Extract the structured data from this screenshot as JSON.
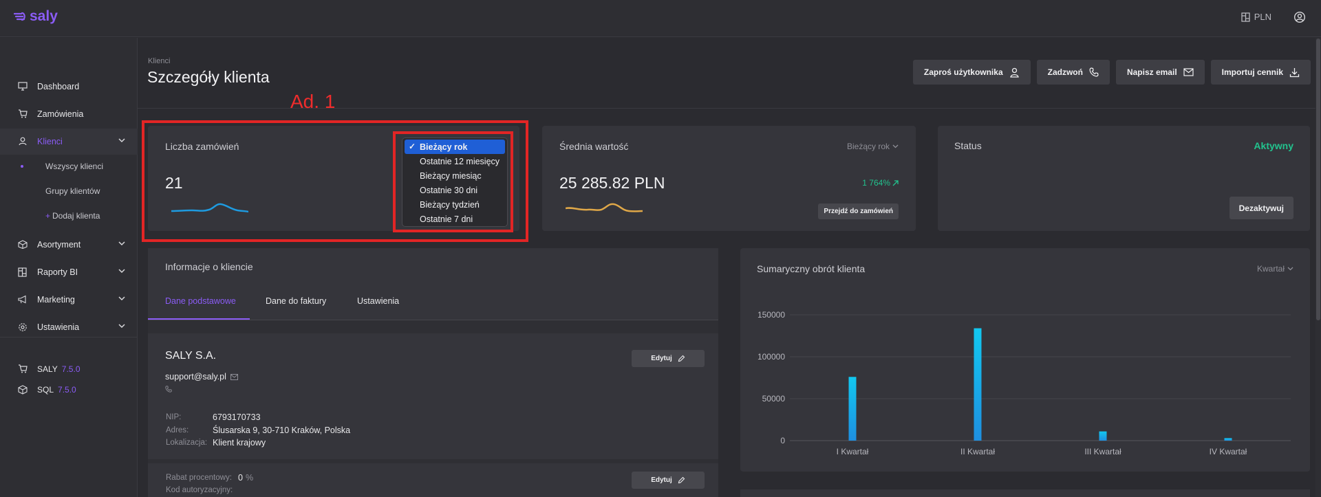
{
  "app": {
    "logo_text": "saly",
    "currency": "PLN"
  },
  "sidebar": {
    "items": [
      {
        "label": "Dashboard",
        "icon": "monitor-icon"
      },
      {
        "label": "Zamówienia",
        "icon": "cart-icon"
      },
      {
        "label": "Klienci",
        "icon": "user-icon"
      },
      {
        "label": "Asortyment",
        "icon": "box-icon"
      },
      {
        "label": "Raporty BI",
        "icon": "report-icon"
      },
      {
        "label": "Marketing",
        "icon": "megaphone-icon"
      },
      {
        "label": "Ustawienia",
        "icon": "gear-icon"
      }
    ],
    "sub_items": [
      {
        "label": "Wszyscy klienci"
      },
      {
        "label": "Grupy klientów"
      },
      {
        "label": "Dodaj klienta",
        "prefix": "+"
      }
    ],
    "versions": [
      {
        "label": "SALY",
        "version": "7.5.0"
      },
      {
        "label": "SQL",
        "version": "7.5.0"
      }
    ]
  },
  "header": {
    "breadcrumb": "Klienci",
    "title": "Szczegóły klienta",
    "actions": [
      {
        "label": "Zaproś użytkownika",
        "icon": "user-icon"
      },
      {
        "label": "Zadzwoń",
        "icon": "phone-icon"
      },
      {
        "label": "Napisz email",
        "icon": "mail-icon"
      },
      {
        "label": "Importuj cennik",
        "icon": "download-icon"
      }
    ]
  },
  "annotation": {
    "label": "Ad. 1"
  },
  "orders_card": {
    "title": "Liczba zamówień",
    "value": "21",
    "dropdown_options": [
      "Bieżący rok",
      "Ostatnie 12 miesięcy",
      "Bieżący miesiąc",
      "Ostatnie 30 dni",
      "Bieżący tydzień",
      "Ostatnie 7 dni"
    ],
    "selected_option": "Bieżący rok",
    "sparkline_color": "#1e9be0"
  },
  "avg_card": {
    "title": "Średnia wartość",
    "period": "Bieżący rok",
    "value": "25 285.82 PLN",
    "trend": "1 764%",
    "button": "Przejdź do zamówień",
    "sparkline_color": "#e0a848"
  },
  "status_card": {
    "title": "Status",
    "value": "Aktywny",
    "button": "Dezaktywuj",
    "value_color": "#22c38e"
  },
  "info": {
    "title": "Informacje o kliencie",
    "tabs": [
      "Dane podstawowe",
      "Dane do faktury",
      "Ustawienia"
    ],
    "active_tab": "Dane podstawowe",
    "company": "SALY S.A.",
    "email": "support@saly.pl",
    "edit_label": "Edytuj",
    "fields": [
      {
        "label": "NIP:",
        "value": "6793170733"
      },
      {
        "label": "Adres:",
        "value": "Ślusarska 9, 30-710 Kraków, Polska"
      },
      {
        "label": "Lokalizacja:",
        "value": "Klient krajowy"
      }
    ],
    "discount_label": "Rabat procentowy:",
    "discount_value": "0",
    "discount_unit": "%",
    "auth_code_label": "Kod autoryzacyjny:"
  },
  "chart_data": {
    "type": "bar",
    "title": "Sumaryczny obrót klienta",
    "period_dropdown": "Kwartał",
    "categories": [
      "I Kwartał",
      "II Kwartał",
      "III Kwartał",
      "IV Kwartał"
    ],
    "values": [
      76000,
      134000,
      11000,
      3000
    ],
    "ylim": [
      0,
      150000
    ],
    "yticks": [
      0,
      50000,
      100000,
      150000
    ],
    "grid": true,
    "bar_color": "#1e8fe0"
  }
}
